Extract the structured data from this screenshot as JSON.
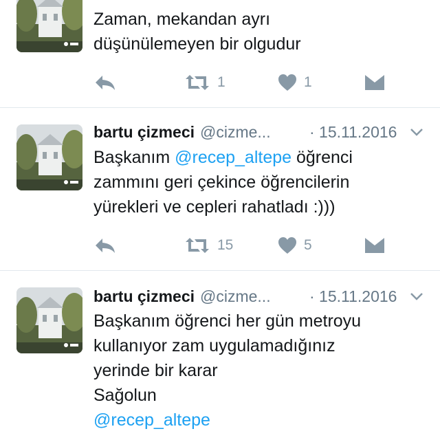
{
  "tweets": [
    {
      "text": "Zaman, mekandan ayrı\ndüşünülemeyen bir olgudur",
      "retweets": "1",
      "likes": "1"
    },
    {
      "name": "bartu çizmeci",
      "handle": "@cizme...",
      "date": "· 15.11.2016",
      "text_before": "Başkanım ",
      "mention": "@recep_altepe",
      "text_after": " öğrenci\nzammını geri çekince öğrencilerin\nyürekleri ve cepleri rahatladı :)))",
      "retweets": "15",
      "likes": "5"
    },
    {
      "name": "bartu çizmeci",
      "handle": "@cizme...",
      "date": "· 15.11.2016",
      "text": "Başkanım öğrenci her gün metroyu\nkullanıyor zam uygulamadığınız\nyerinde bir karar\nSağolun",
      "mention": "@recep_altepe"
    }
  ],
  "colors": {
    "accent": "#1da1f2",
    "secondary_text": "#657786",
    "icon": "#8899a6",
    "divider": "#e1e8ed"
  }
}
